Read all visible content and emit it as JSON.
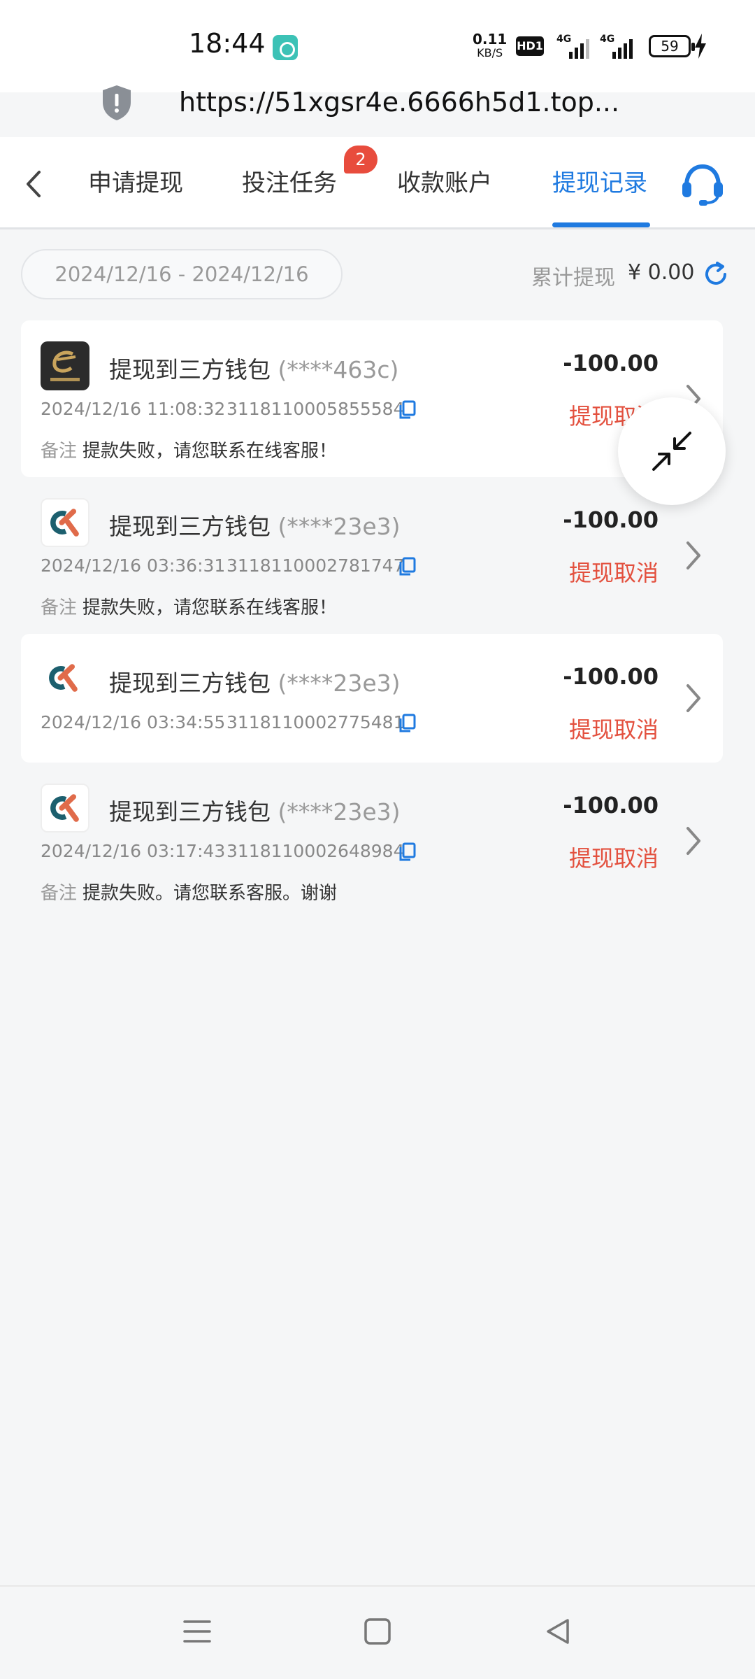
{
  "status_bar": {
    "time": "18:44",
    "net_speed_value": "0.11",
    "net_speed_unit": "KB/S",
    "hd_label": "HD1",
    "signal_1_label": "4G",
    "signal_2_label": "4G",
    "battery": "59",
    "icons": [
      "app-notification-icon",
      "signal-icon",
      "signal-icon",
      "battery-icon",
      "charging-icon"
    ]
  },
  "browser": {
    "url": "https://51xgsr4e.6666h5d1.top..."
  },
  "tabs": [
    {
      "label": "申请提现",
      "active": false
    },
    {
      "label": "投注任务",
      "active": false,
      "badge": "2"
    },
    {
      "label": "收款账户",
      "active": false
    },
    {
      "label": "提现记录",
      "active": true
    }
  ],
  "filter": {
    "date_range": "2024/12/16 - 2024/12/16",
    "total_label": "累计提现",
    "total_value": "¥ 0.00"
  },
  "records": [
    {
      "logo": "topay-logo",
      "title": "提现到三方钱包",
      "account": "(****463c)",
      "amount": "-100.00",
      "status": "提现取消",
      "time": "2024/12/16 11:08:32",
      "order_no": "3118110005855584",
      "note_label": "备注",
      "note": "提款失败，请您联系在线客服！"
    },
    {
      "logo": "ck-logo",
      "title": "提现到三方钱包",
      "account": "(****23e3)",
      "amount": "-100.00",
      "status": "提现取消",
      "time": "2024/12/16 03:36:31",
      "order_no": "3118110002781747",
      "note_label": "备注",
      "note": "提款失败，请您联系在线客服！"
    },
    {
      "logo": "ck-logo",
      "title": "提现到三方钱包",
      "account": "(****23e3)",
      "amount": "-100.00",
      "status": "提现取消",
      "time": "2024/12/16 03:34:55",
      "order_no": "3118110002775481"
    },
    {
      "logo": "ck-logo",
      "title": "提现到三方钱包",
      "account": "(****23e3)",
      "amount": "-100.00",
      "status": "提现取消",
      "time": "2024/12/16 03:17:43",
      "order_no": "3118110002648984",
      "note_label": "备注",
      "note": "提款失败。请您联系客服。谢谢"
    }
  ],
  "colors": {
    "accent": "#1f7ae0",
    "status_cancel": "#e3503e",
    "badge": "#e84c3d"
  }
}
